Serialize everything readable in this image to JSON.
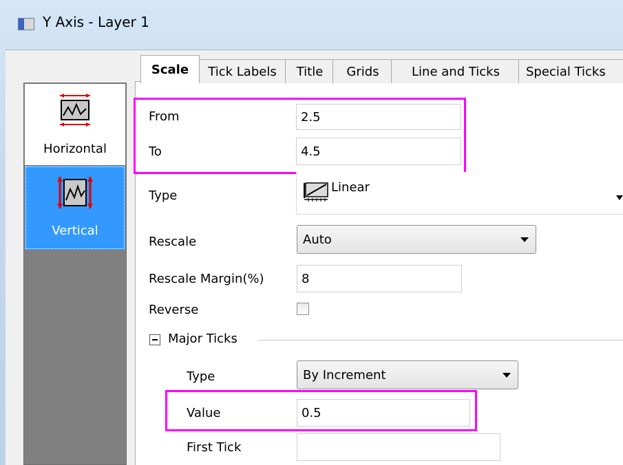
{
  "window": {
    "title": "Y Axis - Layer 1"
  },
  "selector": {
    "items": [
      {
        "label": "Horizontal",
        "selected": false,
        "icon": "horizontal-axis-icon"
      },
      {
        "label": "Vertical",
        "selected": true,
        "icon": "vertical-axis-icon"
      }
    ]
  },
  "tabs": [
    {
      "label": "Scale",
      "active": true
    },
    {
      "label": "Tick Labels",
      "active": false
    },
    {
      "label": "Title",
      "active": false
    },
    {
      "label": "Grids",
      "active": false
    },
    {
      "label": "Line and Ticks",
      "active": false
    },
    {
      "label": "Special Ticks",
      "active": false
    }
  ],
  "scale": {
    "from": {
      "label": "From",
      "value": "2.5"
    },
    "to": {
      "label": "To",
      "value": "4.5"
    },
    "type": {
      "label": "Type",
      "value": "Linear",
      "icon": "linear-scale-icon"
    },
    "rescale": {
      "label": "Rescale",
      "value": "Auto"
    },
    "rescale_margin": {
      "label": "Rescale Margin(%)",
      "value": "8"
    },
    "reverse": {
      "label": "Reverse",
      "checked": false
    }
  },
  "major_ticks": {
    "group_label": "Major Ticks",
    "type": {
      "label": "Type",
      "value": "By Increment"
    },
    "value": {
      "label": "Value",
      "value": "0.5"
    },
    "first_tick": {
      "label": "First Tick",
      "value": ""
    }
  },
  "colors": {
    "highlight": "#ff00ff",
    "selection": "#3399ff",
    "selector_bg": "#808080"
  }
}
